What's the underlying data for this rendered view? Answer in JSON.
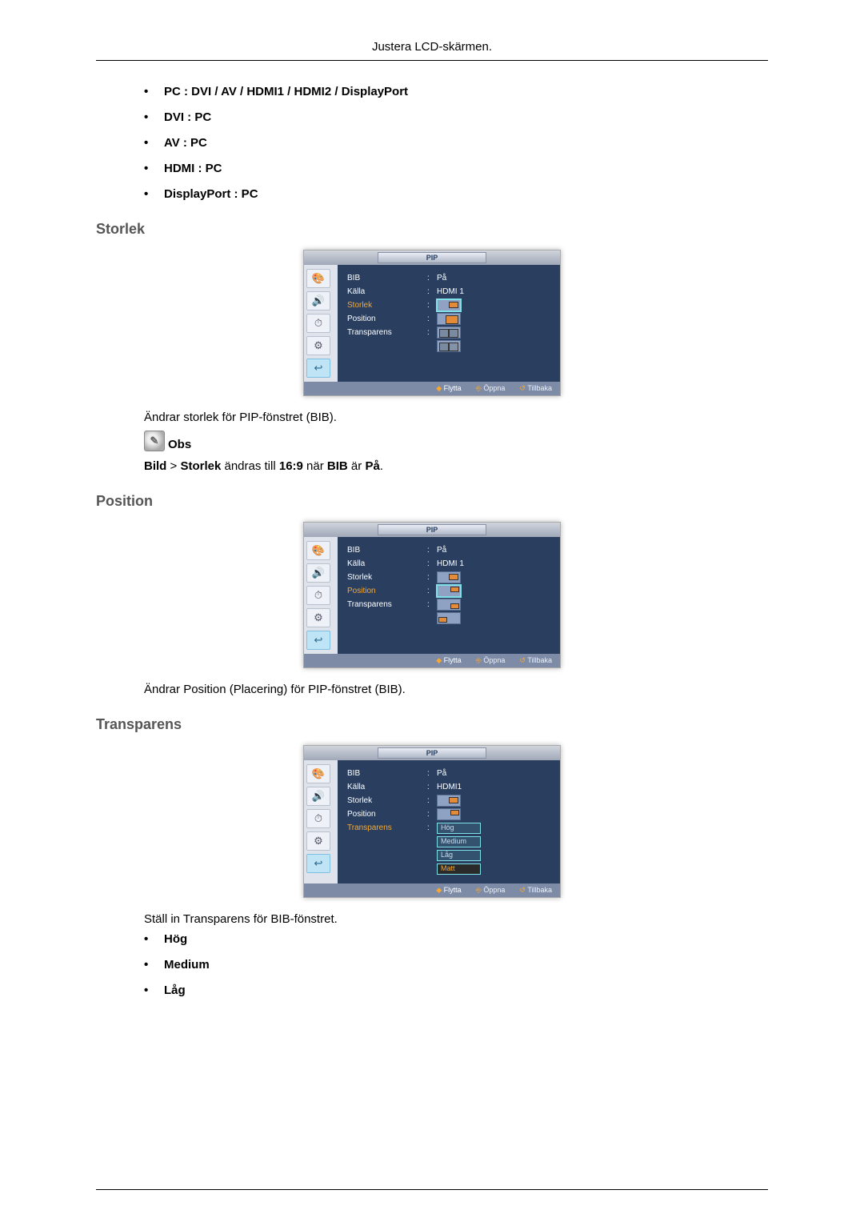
{
  "header": {
    "title": "Justera LCD-skärmen."
  },
  "sources": {
    "pc": "PC : DVI / AV / HDMI1 / HDMI2 / DisplayPort",
    "dvi": "DVI : PC",
    "av": "AV : PC",
    "hdmi": "HDMI : PC",
    "dp": "DisplayPort : PC"
  },
  "section_storlek": {
    "heading": "Storlek",
    "desc": "Ändrar storlek för PIP-fönstret (BIB).",
    "note_label": "Obs",
    "note_before": "Bild",
    "note_gt": " > ",
    "note_storlek": "Storlek",
    "note_mid": " ändras till ",
    "note_ratio": "16:9",
    "note_nar": " när ",
    "note_bib": "BIB",
    "note_ar": " är ",
    "note_pa": "På",
    "note_dot": "."
  },
  "section_position": {
    "heading": "Position",
    "desc": "Ändrar Position (Placering) för PIP-fönstret (BIB)."
  },
  "section_transparens": {
    "heading": "Transparens",
    "desc": "Ställ in Transparens för BIB-fönstret.",
    "hog": "Hög",
    "medium": "Medium",
    "lag": "Låg"
  },
  "osd_common": {
    "tab": "PIP",
    "bib": "BIB",
    "kalla": "Källa",
    "storlek": "Storlek",
    "position": "Position",
    "transparens": "Transparens",
    "pa": "På",
    "hdmi1": "HDMI 1",
    "hdmi1b": "HDMI1",
    "flytta": "Flytta",
    "oppna": "Öppna",
    "tillbaka": "Tillbaka"
  },
  "osd_trans": {
    "hog": "Hög",
    "medium": "Medium",
    "lag": "Låg",
    "matt": "Matt"
  }
}
